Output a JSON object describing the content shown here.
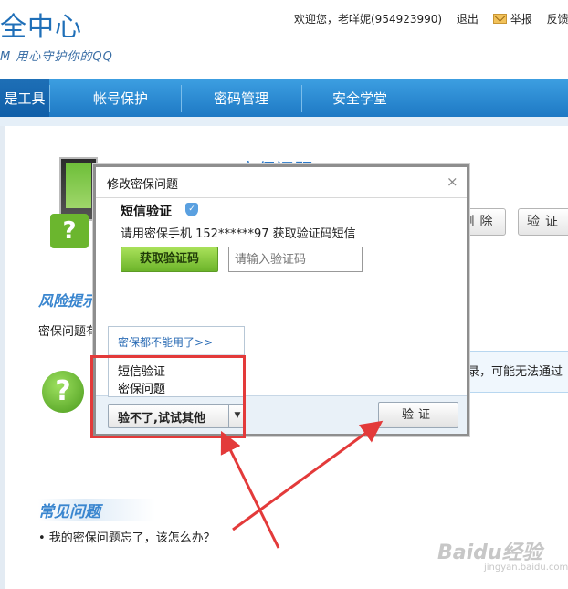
{
  "header": {
    "logo_title": "全中心",
    "logo_sub": "M 用心守护你的QQ",
    "welcome": "欢迎您，老咩妮(954923990)",
    "logout": "退出",
    "report": "举报",
    "feedback": "反馈意"
  },
  "nav": {
    "items": [
      "是工具",
      "帐号保护",
      "密码管理",
      "安全学堂"
    ]
  },
  "background": {
    "title": "密保问题",
    "delete_label": "删除",
    "verify_label": "验证",
    "risk_title": "风险提示",
    "risk_text": "密保问题有",
    "info_text": "录，可能无法通过",
    "faq_title": "常见问题",
    "faq_item": "• 我的密保问题忘了，该怎么办？",
    "watermark": "Baidu经验",
    "watermark_sub": "jingyan.baidu.com"
  },
  "dialog": {
    "title": "修改密保问题",
    "close": "×",
    "sms_title": "短信验证",
    "sms_desc": "请用密保手机 152******97 获取验证码短信",
    "get_code": "获取验证码",
    "code_placeholder": "请输入验证码",
    "menu_head": "密保都不能用了>>",
    "menu_items": [
      "短信验证",
      "密保问题"
    ],
    "try_other": "验不了,试试其他",
    "verify": "验证"
  },
  "colors": {
    "nav_blue": "#1e79c4",
    "accent_green": "#6cb42a",
    "annotation_red": "#e33a3a"
  }
}
